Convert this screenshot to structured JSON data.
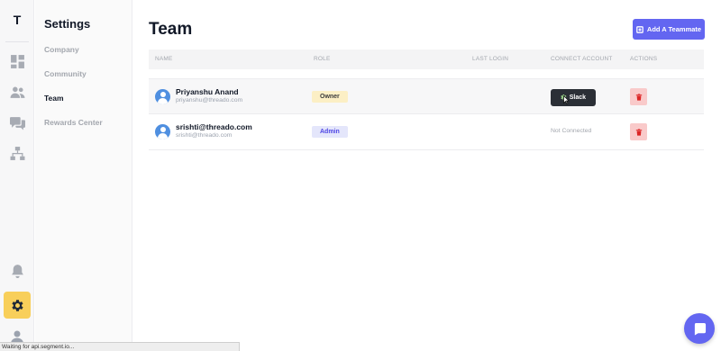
{
  "app": {
    "logo_letter": "T"
  },
  "rail": {
    "items": [
      {
        "icon": "dashboard-icon"
      },
      {
        "icon": "users-icon"
      },
      {
        "icon": "chat-bubbles-icon"
      },
      {
        "icon": "org-chart-icon"
      },
      {
        "icon": "bell-icon"
      },
      {
        "icon": "gear-icon",
        "active": true
      },
      {
        "icon": "profile-icon"
      }
    ],
    "active_color": "#f8cf5a"
  },
  "settings": {
    "title": "Settings",
    "nav": [
      {
        "label": "Company",
        "active": false
      },
      {
        "label": "Community",
        "active": false
      },
      {
        "label": "Team",
        "active": true
      },
      {
        "label": "Rewards Center",
        "active": false
      }
    ]
  },
  "page": {
    "title": "Team",
    "add_button_label": "Add A Teammate",
    "accent_color": "#6366f1"
  },
  "table": {
    "columns": [
      "NAME",
      "ROLE",
      "LAST LOGIN",
      "CONNECT ACCOUNT",
      "ACTIONS"
    ],
    "rows": [
      {
        "name": "Priyanshu Anand",
        "email": "priyanshu@threado.com",
        "role": "Owner",
        "last_login": "",
        "connect": "Slack",
        "connected": true
      },
      {
        "name": "srishti@threado.com",
        "email": "srishti@threado.com",
        "role": "Admin",
        "last_login": "",
        "connect": "Not Connected",
        "connected": false
      }
    ]
  },
  "status_bar": {
    "text": "Waiting for api.segment.io..."
  }
}
